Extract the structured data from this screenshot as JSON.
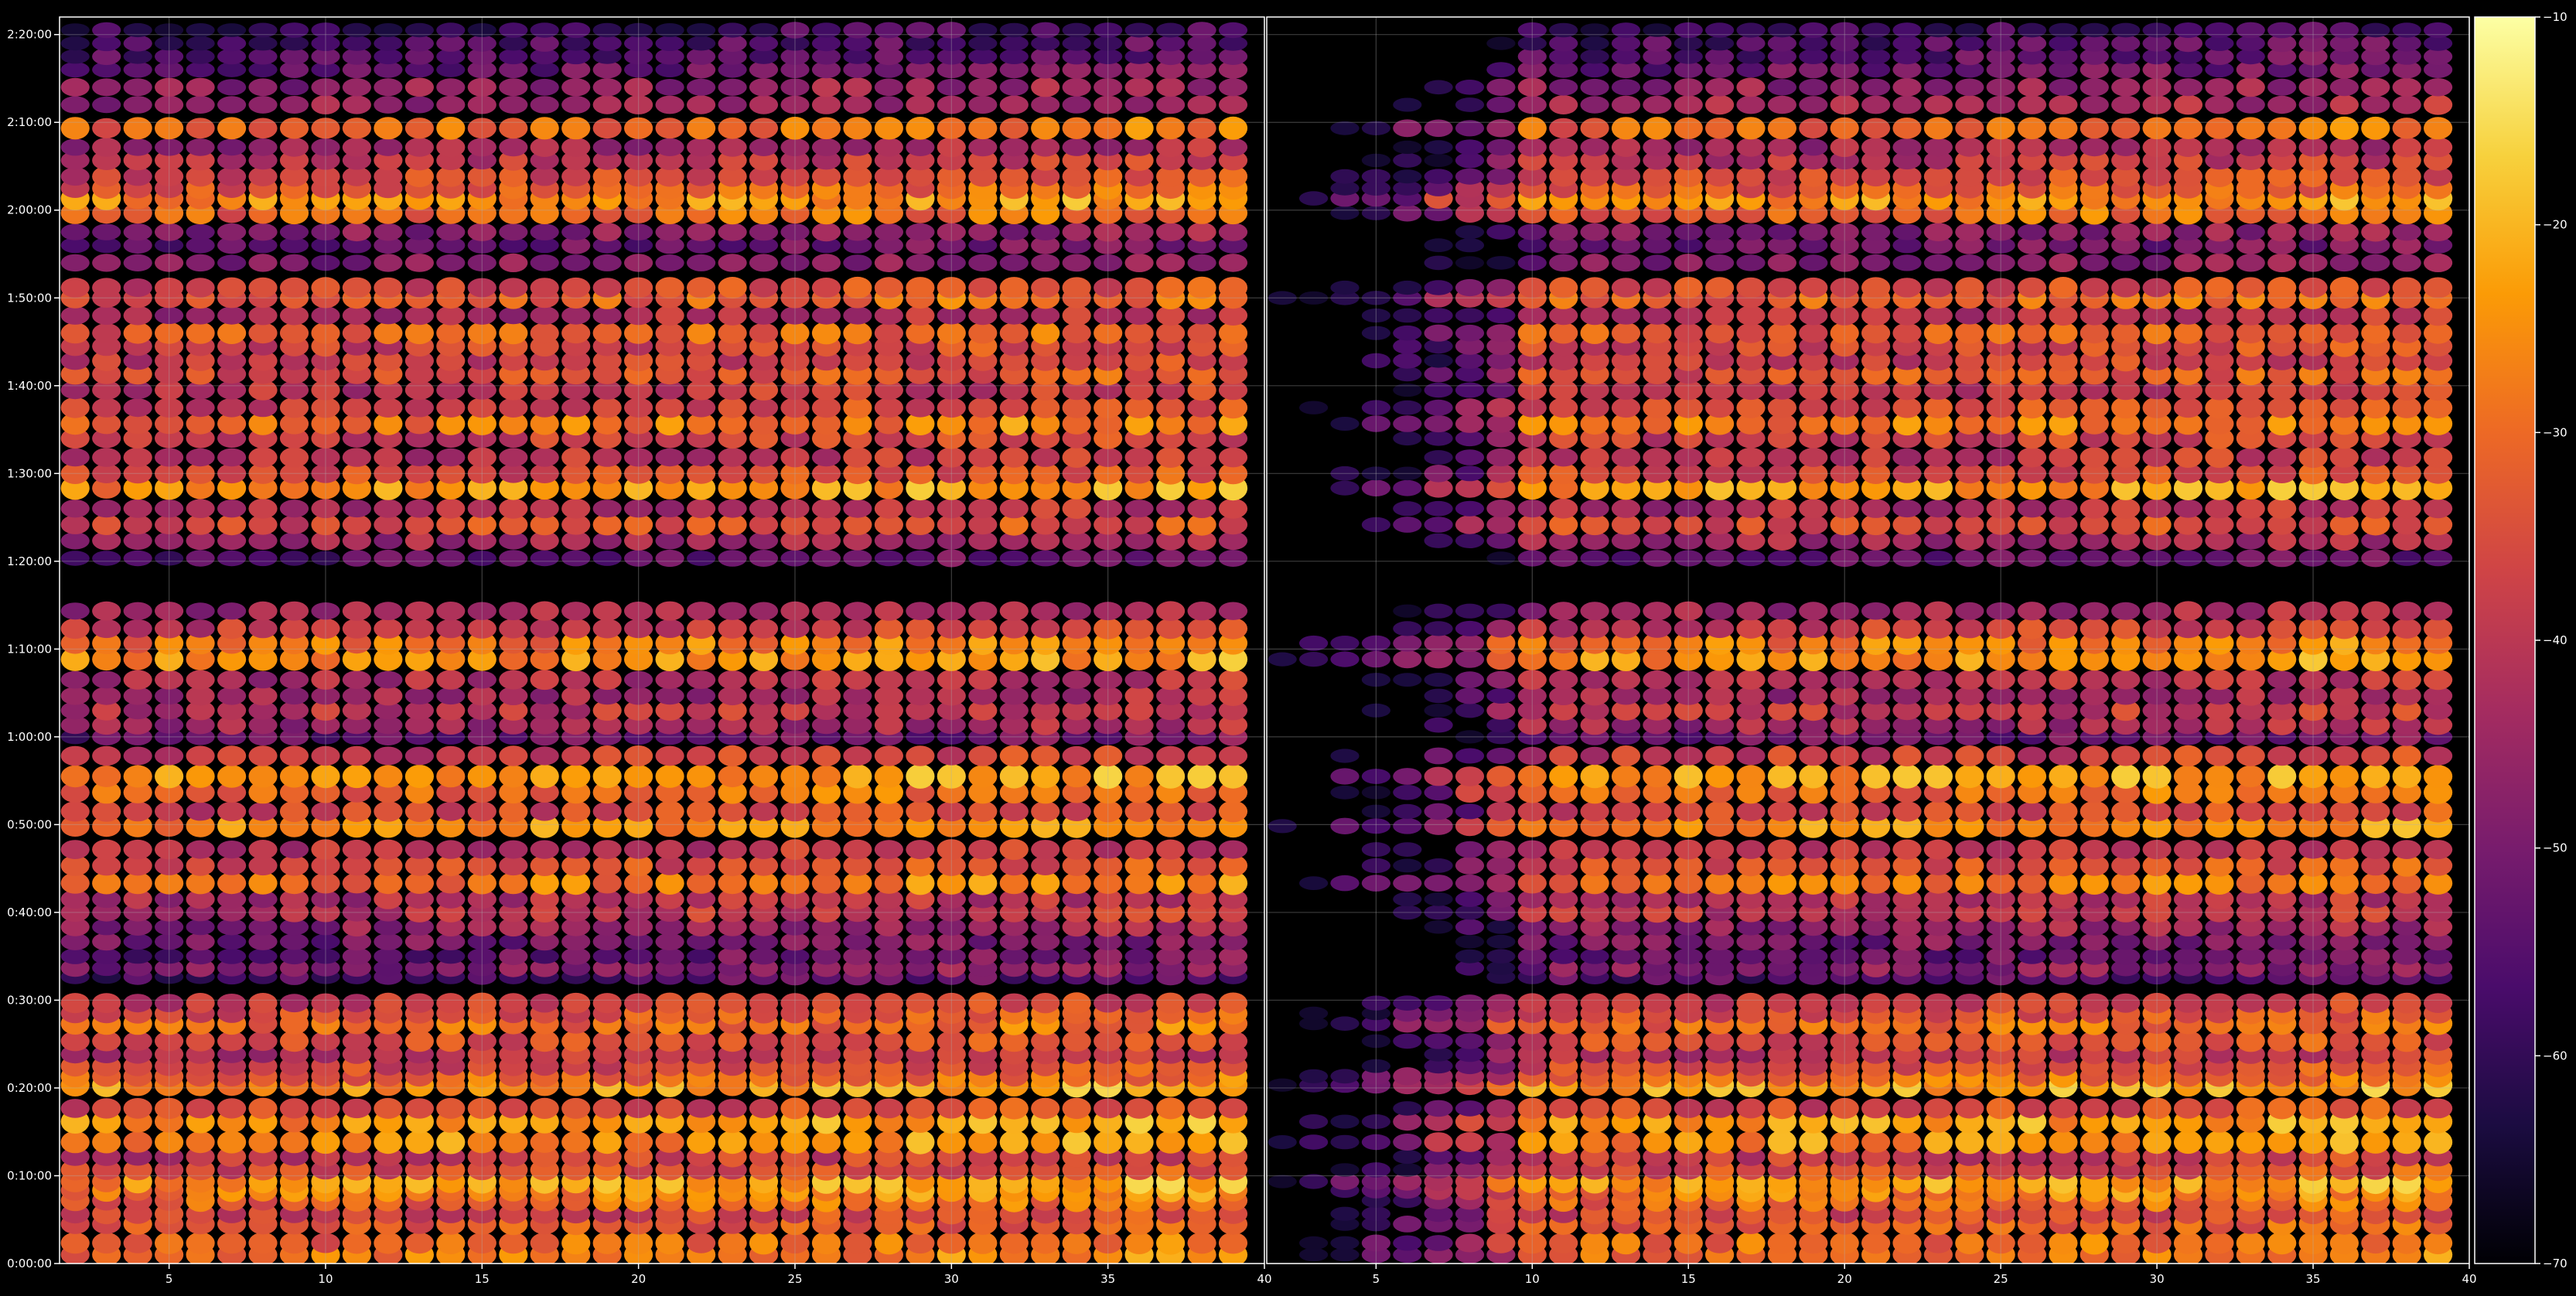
{
  "chart_data": [
    {
      "type": "heatmap",
      "panel": "left",
      "title": "",
      "xlabel": "",
      "ylabel": "",
      "xlim": [
        1.5,
        40
      ],
      "ylim": [
        0,
        8520
      ],
      "x_ticks": [
        5,
        10,
        15,
        20,
        25,
        30,
        35,
        40
      ],
      "x_tick_labels": [
        "5",
        "10",
        "15",
        "20",
        "25",
        "30",
        "35",
        "40"
      ],
      "y_ticks": [
        0,
        600,
        1200,
        1800,
        2400,
        3000,
        3600,
        4200,
        4800,
        5400,
        6000,
        6600,
        7200,
        7800,
        8400
      ],
      "y_tick_labels": [
        "0:00:00",
        "0:10:00",
        "0:20:00",
        "0:30:00",
        "0:40:00",
        "0:50:00",
        "1:00:00",
        "1:10:00",
        "1:20:00",
        "1:30:00",
        "1:40:00",
        "1:50:00",
        "2:00:00",
        "2:10:00",
        "2:20:00"
      ],
      "grid": true,
      "colormap": "inferno",
      "value_range": [
        -70,
        -10
      ],
      "columns_start": 2,
      "columns_end": 39,
      "row_profile": [
        {
          "t": 60,
          "v": -28
        },
        {
          "t": 140,
          "v": -30
        },
        {
          "t": 270,
          "v": -33
        },
        {
          "t": 340,
          "v": -36
        },
        {
          "t": 430,
          "v": -30
        },
        {
          "t": 500,
          "v": -27
        },
        {
          "t": 560,
          "v": -23
        },
        {
          "t": 640,
          "v": -35
        },
        {
          "t": 730,
          "v": -38
        },
        {
          "t": 830,
          "v": -25
        },
        {
          "t": 970,
          "v": -24
        },
        {
          "t": 1060,
          "v": -36
        },
        {
          "t": 1220,
          "v": -23
        },
        {
          "t": 1280,
          "v": -30
        },
        {
          "t": 1350,
          "v": -35
        },
        {
          "t": 1430,
          "v": -40
        },
        {
          "t": 1520,
          "v": -35
        },
        {
          "t": 1640,
          "v": -30
        },
        {
          "t": 1710,
          "v": -34
        },
        {
          "t": 1780,
          "v": -38
        },
        {
          "t": 1960,
          "v": -55
        },
        {
          "t": 2020,
          "v": -48
        },
        {
          "t": 2100,
          "v": -52
        },
        {
          "t": 2200,
          "v": -50
        },
        {
          "t": 2300,
          "v": -46
        },
        {
          "t": 2400,
          "v": -40
        },
        {
          "t": 2490,
          "v": -42
        },
        {
          "t": 2600,
          "v": -28
        },
        {
          "t": 2720,
          "v": -35
        },
        {
          "t": 2830,
          "v": -40
        },
        {
          "t": 2990,
          "v": -25
        },
        {
          "t": 3090,
          "v": -36
        },
        {
          "t": 3220,
          "v": -30
        },
        {
          "t": 3330,
          "v": -24
        },
        {
          "t": 3470,
          "v": -38
        },
        {
          "t": 3600,
          "v": -52
        },
        {
          "t": 3680,
          "v": -44
        },
        {
          "t": 3780,
          "v": -40
        },
        {
          "t": 3880,
          "v": -44
        },
        {
          "t": 3990,
          "v": -42
        },
        {
          "t": 4130,
          "v": -25
        },
        {
          "t": 4240,
          "v": -28
        },
        {
          "t": 4340,
          "v": -38
        },
        {
          "t": 4460,
          "v": -44
        },
        {
          "t": 4820,
          "v": -54
        },
        {
          "t": 4940,
          "v": -44
        },
        {
          "t": 5050,
          "v": -35
        },
        {
          "t": 5160,
          "v": -42
        },
        {
          "t": 5300,
          "v": -24
        },
        {
          "t": 5400,
          "v": -35
        },
        {
          "t": 5510,
          "v": -40
        },
        {
          "t": 5640,
          "v": -38
        },
        {
          "t": 5740,
          "v": -28
        },
        {
          "t": 5850,
          "v": -36
        },
        {
          "t": 5970,
          "v": -40
        },
        {
          "t": 6080,
          "v": -34
        },
        {
          "t": 6170,
          "v": -38
        },
        {
          "t": 6270,
          "v": -36
        },
        {
          "t": 6360,
          "v": -32
        },
        {
          "t": 6480,
          "v": -42
        },
        {
          "t": 6600,
          "v": -31
        },
        {
          "t": 6670,
          "v": -36
        },
        {
          "t": 6840,
          "v": -48
        },
        {
          "t": 6960,
          "v": -52
        },
        {
          "t": 7050,
          "v": -48
        },
        {
          "t": 7180,
          "v": -30
        },
        {
          "t": 7280,
          "v": -24
        },
        {
          "t": 7350,
          "v": -32
        },
        {
          "t": 7430,
          "v": -36
        },
        {
          "t": 7540,
          "v": -40
        },
        {
          "t": 7630,
          "v": -44
        },
        {
          "t": 7760,
          "v": -30
        },
        {
          "t": 7920,
          "v": -44
        },
        {
          "t": 8040,
          "v": -46
        },
        {
          "t": 8160,
          "v": -52
        },
        {
          "t": 8250,
          "v": -54
        },
        {
          "t": 8340,
          "v": -56
        },
        {
          "t": 8430,
          "v": -58
        }
      ]
    },
    {
      "type": "heatmap",
      "panel": "right",
      "title": "",
      "xlabel": "",
      "ylabel": "",
      "xlim": [
        1.5,
        40
      ],
      "ylim": [
        0,
        8520
      ],
      "x_ticks": [
        5,
        10,
        15,
        20,
        25,
        30,
        35,
        40
      ],
      "x_tick_labels": [
        "5",
        "10",
        "15",
        "20",
        "25",
        "30",
        "35",
        "40"
      ],
      "grid": true,
      "colormap": "inferno",
      "value_range": [
        -70,
        -10
      ],
      "columns_start": 2,
      "columns_end": 39,
      "low_signal_columns": [
        2,
        3,
        4,
        5,
        6,
        7,
        8,
        9
      ],
      "row_profile_same_as_left": true
    }
  ],
  "colorbar": {
    "range": [
      -70,
      -10
    ],
    "ticks": [
      -70,
      -60,
      -50,
      -40,
      -30,
      -20,
      -10
    ],
    "tick_labels": [
      "−70",
      "−60",
      "−50",
      "−40",
      "−30",
      "−20",
      "−10"
    ],
    "stops": [
      "#000004",
      "#1b0c41",
      "#4a0c6b",
      "#781c6d",
      "#a52c60",
      "#cf4446",
      "#ed6925",
      "#fb9b06",
      "#f7d13d",
      "#fcffa4"
    ]
  },
  "colors": {
    "background": "#000000",
    "axis": "#ffffff",
    "grid": "#b0b0b0"
  }
}
